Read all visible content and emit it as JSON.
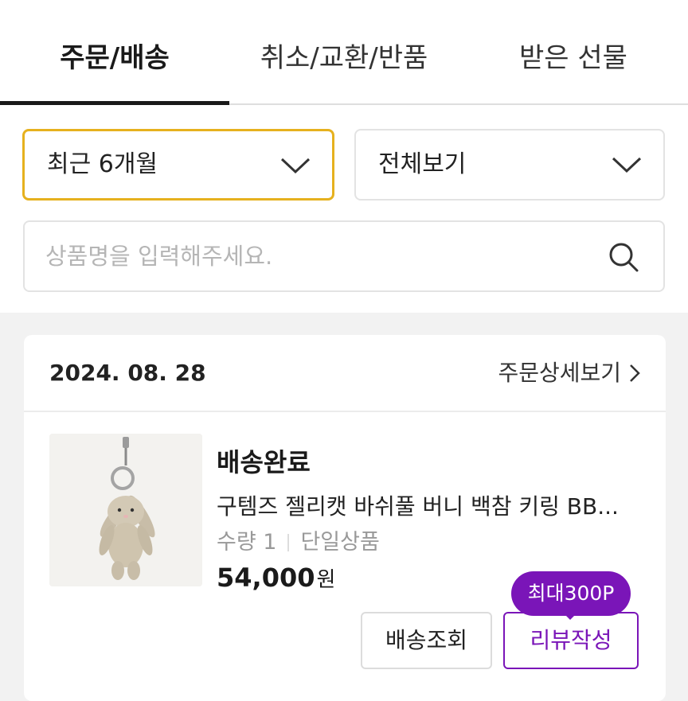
{
  "tabs": [
    {
      "label": "주문/배송",
      "active": true
    },
    {
      "label": "취소/교환/반품",
      "active": false
    },
    {
      "label": "받은 선물",
      "active": false
    }
  ],
  "filters": {
    "period": "최근 6개월",
    "type": "전체보기"
  },
  "search": {
    "placeholder": "상품명을 입력해주세요."
  },
  "order": {
    "date": "2024. 08. 28",
    "detail_link": "주문상세보기",
    "status": "배송완료",
    "product_name": "구템즈 젤리캣 바쉬풀 버니 백참 키링 BB...",
    "quantity": "수량 1",
    "option": "단일상품",
    "price": "54,000",
    "price_unit": "원",
    "buttons": {
      "track": "배송조회",
      "review": "리뷰작성"
    },
    "review_badge": "최대300P"
  },
  "colors": {
    "accent": "#7a15b8",
    "focus_border": "#e6b11e"
  }
}
